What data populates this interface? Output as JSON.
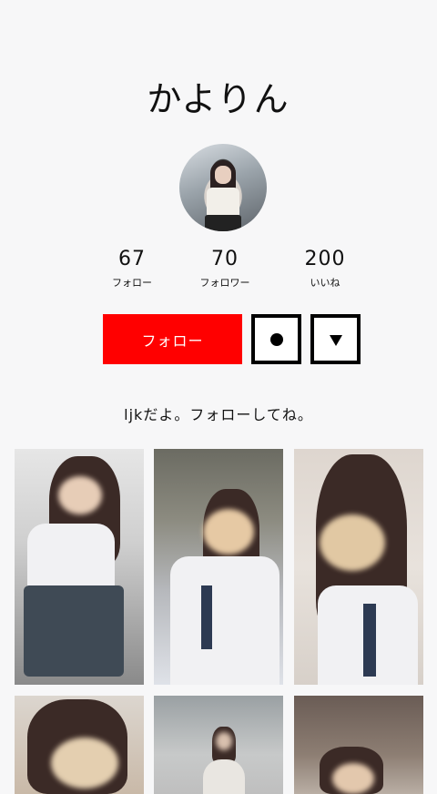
{
  "profile": {
    "name": "かよりん",
    "bio": "ljkだよ。フォローしてね。"
  },
  "stats": [
    {
      "value": "67",
      "label": "フォロー"
    },
    {
      "value": "70",
      "label": "フォロワー"
    },
    {
      "value": "200",
      "label": "いいね"
    }
  ],
  "actions": {
    "follow_label": "フォロー"
  },
  "icons": {
    "dot": "dot-icon",
    "dropdown": "triangle-down-icon"
  },
  "colors": {
    "accent": "#ff0000",
    "background": "#f7f7f8"
  },
  "posts_count_visible": 6
}
